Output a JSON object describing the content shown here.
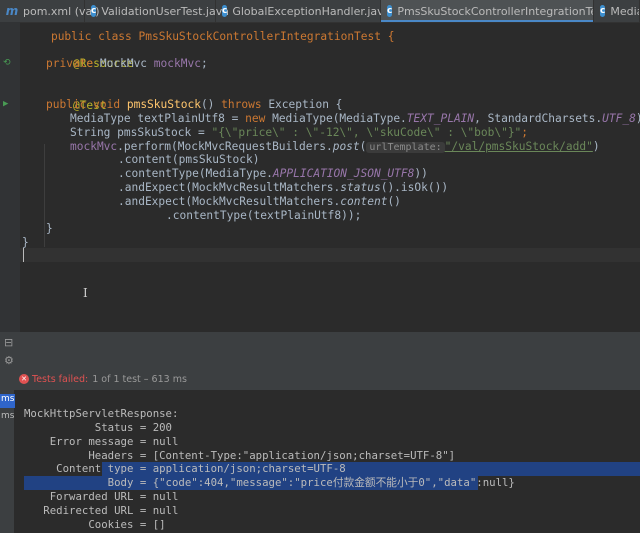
{
  "tabs": [
    {
      "label": "pom.xml (val)",
      "icon": "maven-icon",
      "active": false
    },
    {
      "label": "ValidationUserTest.java",
      "icon": "class-icon",
      "active": false
    },
    {
      "label": "GlobalExceptionHandler.java",
      "icon": "class-icon",
      "active": false
    },
    {
      "label": "PmsSkuStockControllerIntegrationTest.java",
      "icon": "class-icon",
      "active": true
    },
    {
      "label": "MediaType",
      "icon": "class-icon",
      "active": false
    }
  ],
  "code": {
    "class_decl": "public class PmsSkuStockControllerIntegrationTest {",
    "resource_ann": "@Resource",
    "field_kw": "private",
    "field_type": " MockMvc ",
    "field_name": "mockMvc",
    "test_ann": "@Test",
    "m_kw1": "public",
    "m_kw2": " void ",
    "m_name": "pmsSkuStock",
    "m_paren": "() ",
    "m_throws": "throws",
    "m_exc": " Exception {",
    "l1_a": "MediaType textPlainUtf8 = ",
    "l1_new": "new",
    "l1_b": " MediaType(MediaType.",
    "l1_c1": "TEXT_PLAIN",
    "l1_d": ", StandardCharsets.",
    "l1_c2": "UTF_8",
    "l1_e": ");",
    "l2_a": "String pmsSkuStock = ",
    "l2_str": "\"{\\\"price\\\" : \\\"-12\\\", \\\"skuCode\\\" : \\\"bob\\\"}\"",
    "l2_e": ";",
    "l3_f": "mockMvc",
    "l3_a": ".perform(MockMvcRequestBuilders.",
    "l3_post": "post",
    "l3_paren": "(",
    "l3_hint": "urlTemplate:",
    "l3_url": "\"/val/pmsSkuStock/add\"",
    "l3_e": ")",
    "l4": ".content(pmsSkuStock)",
    "l5_a": ".contentType(MediaType.",
    "l5_c": "APPLICATION_JSON_UTF8",
    "l5_e": "))",
    "l6_a": ".andExpect(MockMvcResultMatchers.",
    "l6_s": "status",
    "l6_e": "().isOk())",
    "l7_a": ".andExpect(MockMvcResultMatchers.",
    "l7_c": "content",
    "l7_e": "()",
    "l8": ".contentType(textPlainUtf8));",
    "close_inner": "}",
    "close_outer": "}"
  },
  "test_status": {
    "failed_label": "Tests failed:",
    "count_text": "1 of 1 test – 613 ms"
  },
  "left_times": [
    "ms",
    "ms"
  ],
  "output": {
    "heading": "MockHttpServletResponse:",
    "status": "           Status = 200",
    "error": "    Error message = null",
    "headers": "          Headers = [Content-Type:\"application/json;charset=UTF-8\"]",
    "ct_a": "     Content",
    "ct_b": " type = application/json;charset=UTF-8",
    "body": "             Body = {\"code\":404,\"message\":\"price付款金额不能小于0\",\"data\":null}",
    "fwd": "    Forwarded URL = null",
    "redir": "   Redirected URL = null",
    "cookies": "          Cookies = []"
  }
}
